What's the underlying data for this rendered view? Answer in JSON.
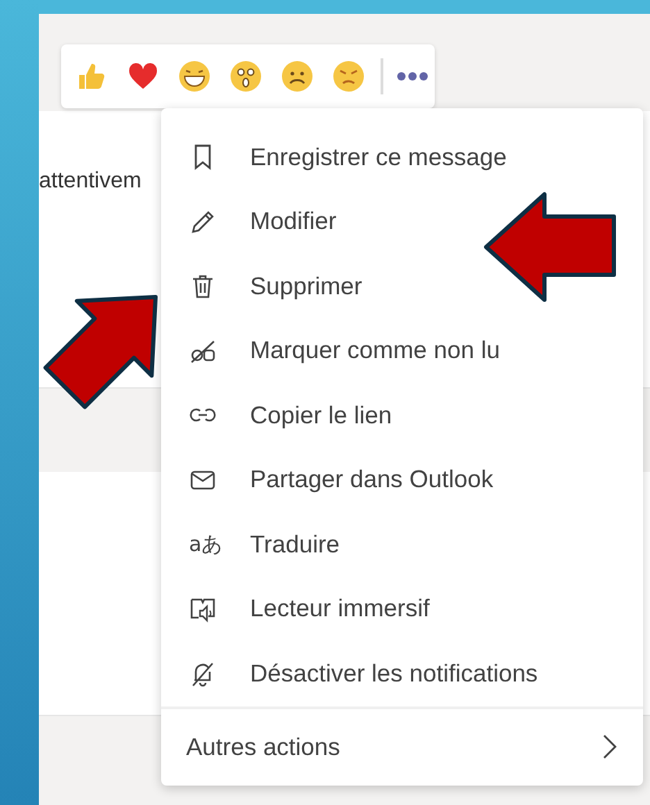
{
  "message": {
    "text": "attentivem"
  },
  "menu": {
    "items": [
      {
        "kind": "bookmark",
        "label": "Enregistrer ce message"
      },
      {
        "kind": "pencil",
        "label": "Modifier"
      },
      {
        "kind": "trash",
        "label": "Supprimer"
      },
      {
        "kind": "unread",
        "label": "Marquer comme non lu"
      },
      {
        "kind": "link",
        "label": "Copier le lien"
      },
      {
        "kind": "mail",
        "label": "Partager dans Outlook"
      },
      {
        "kind": "translate",
        "label": "Traduire",
        "icon_text": "aあ"
      },
      {
        "kind": "reader",
        "label": "Lecteur immersif"
      },
      {
        "kind": "bell-off",
        "label": "Désactiver les notifications"
      }
    ],
    "footer": {
      "label": "Autres actions"
    }
  }
}
